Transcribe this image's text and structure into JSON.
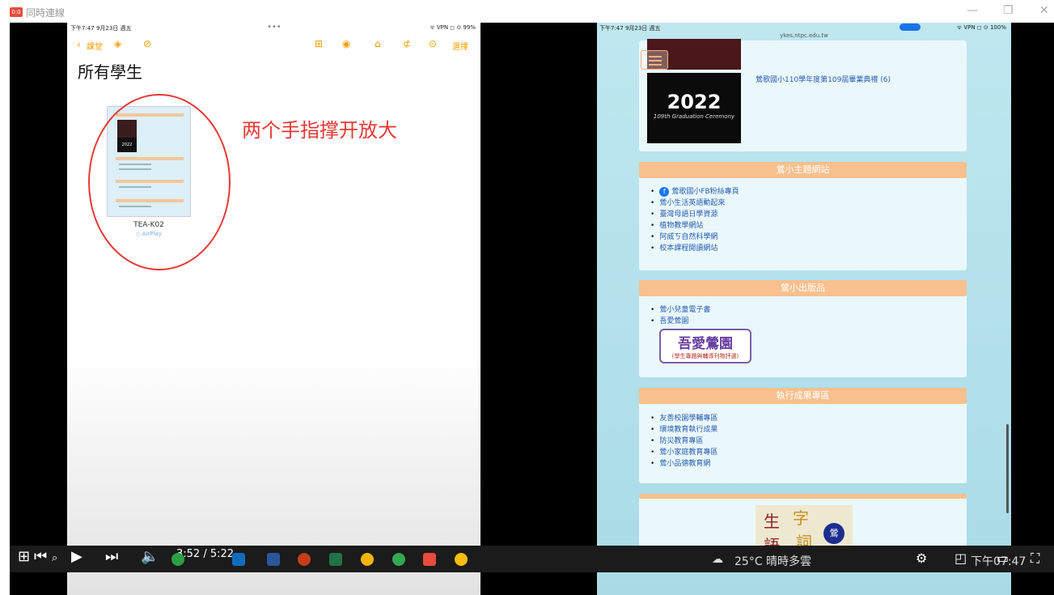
{
  "window": {
    "title": "同時連線",
    "logo_text": "0:0",
    "controls": {
      "minimize": "—",
      "maximize": "❐",
      "close": "✕"
    }
  },
  "left_ipad": {
    "status_time": "下午7:47  9月23日 週五",
    "status_dots": "•••",
    "status_right": "ᯤ VPN ◻ ⊙ 99%",
    "toolbar": {
      "back_label": "課堂",
      "select_label": "選擇"
    },
    "page_title": "所有學生",
    "device_name": "TEA-K02",
    "device_status": "◇ AirPlay",
    "thumbnail_year": "2022"
  },
  "annotation": "两个手指撑开放大",
  "right_ipad": {
    "status_time": "下午7:47  9月23日 週五",
    "status_right": "ᯤ VPN ◻ ⊙ 100%",
    "url": "ykes.ntpc.edu.tw",
    "graduation": {
      "year": "2022",
      "subtitle": "109th Graduation Ceremony",
      "caption": "鶯歌國小110學年度第109屆畢業典禮 (6)"
    },
    "sections": [
      {
        "title": "鶯小主題網站",
        "links": [
          "鶯歌國小FB粉絲專頁",
          "鶯小生活英語動起來",
          "臺灣母語日學資源",
          "植物教學網站",
          "阿威ㄎ自然科學網",
          "校本課程閱讀網站"
        ]
      },
      {
        "title": "鶯小出版品",
        "links": [
          "鶯小兒童電子書",
          "吾愛鶯園"
        ]
      },
      {
        "title": "執行成果專區",
        "links": [
          "友善校園學輔專區",
          "環境教育執行成果",
          "防災教育專區",
          "鶯小家庭教育專區",
          "鶯小品德教育網"
        ]
      }
    ],
    "logo": {
      "main": "吾愛鶯園",
      "sub": "(學生專題與輔導刊物評選)"
    },
    "zi": {
      "c1": "生",
      "c2": "字",
      "c3": "語",
      "c4": "詞",
      "badge": "鶯"
    }
  },
  "player": {
    "time": "3:52 / 5:22",
    "progress_fraction": 0.725,
    "buffered_fraction": 0.847
  },
  "taskbar": {
    "weather": "25°C  晴時多雲",
    "clock": "下午07:47"
  }
}
